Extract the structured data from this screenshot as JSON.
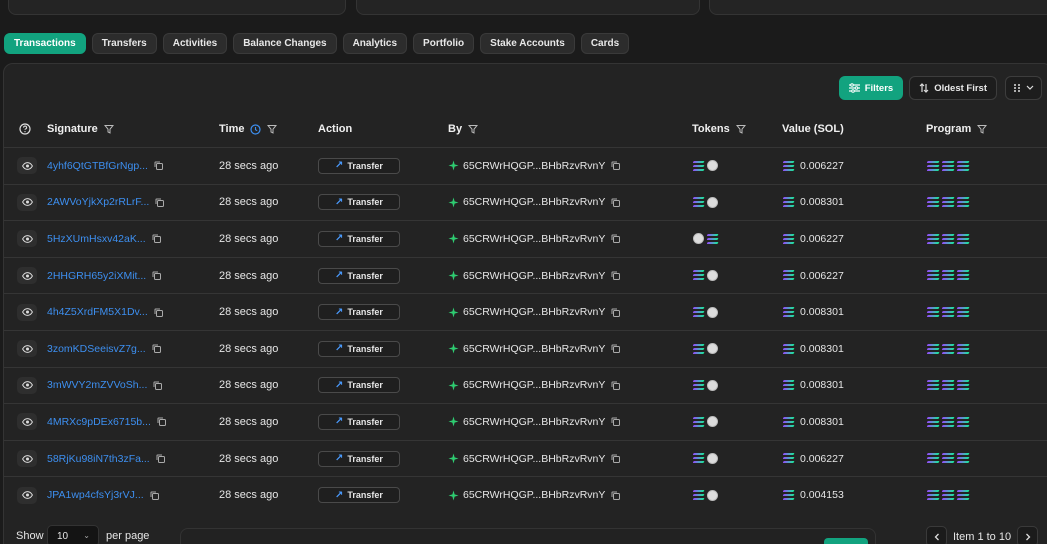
{
  "tabs": [
    {
      "label": "Transactions",
      "active": true
    },
    {
      "label": "Transfers"
    },
    {
      "label": "Activities"
    },
    {
      "label": "Balance Changes"
    },
    {
      "label": "Analytics"
    },
    {
      "label": "Portfolio"
    },
    {
      "label": "Stake Accounts"
    },
    {
      "label": "Cards"
    }
  ],
  "toolbar": {
    "filters_label": "Filters",
    "sort_label": "Oldest First"
  },
  "columns": {
    "signature": "Signature",
    "time": "Time",
    "action": "Action",
    "by": "By",
    "tokens": "Tokens",
    "value": "Value (SOL)",
    "program": "Program"
  },
  "rows": [
    {
      "signature": "4yhf6QtGTBfGrNgp...",
      "time": "28 secs ago",
      "action": "Transfer",
      "by": "65CRWrHQGP...BHbRzvRvnY",
      "tokens_order": [
        "sol",
        "coin"
      ],
      "value": "0.006227"
    },
    {
      "signature": "2AWVoYjkXp2rRLrF...",
      "time": "28 secs ago",
      "action": "Transfer",
      "by": "65CRWrHQGP...BHbRzvRvnY",
      "tokens_order": [
        "sol",
        "coin"
      ],
      "value": "0.008301"
    },
    {
      "signature": "5HzXUmHsxv42aK...",
      "time": "28 secs ago",
      "action": "Transfer",
      "by": "65CRWrHQGP...BHbRzvRvnY",
      "tokens_order": [
        "coin",
        "sol"
      ],
      "value": "0.006227"
    },
    {
      "signature": "2HHGRH65y2iXMit...",
      "time": "28 secs ago",
      "action": "Transfer",
      "by": "65CRWrHQGP...BHbRzvRvnY",
      "tokens_order": [
        "sol",
        "coin"
      ],
      "value": "0.006227"
    },
    {
      "signature": "4h4Z5XrdFM5X1Dv...",
      "time": "28 secs ago",
      "action": "Transfer",
      "by": "65CRWrHQGP...BHbRzvRvnY",
      "tokens_order": [
        "sol",
        "coin"
      ],
      "value": "0.008301"
    },
    {
      "signature": "3zomKDSeeisvZ7g...",
      "time": "28 secs ago",
      "action": "Transfer",
      "by": "65CRWrHQGP...BHbRzvRvnY",
      "tokens_order": [
        "sol",
        "coin"
      ],
      "value": "0.008301"
    },
    {
      "signature": "3mWVY2mZVVoSh...",
      "time": "28 secs ago",
      "action": "Transfer",
      "by": "65CRWrHQGP...BHbRzvRvnY",
      "tokens_order": [
        "sol",
        "coin"
      ],
      "value": "0.008301"
    },
    {
      "signature": "4MRXc9pDEx6715b...",
      "time": "28 secs ago",
      "action": "Transfer",
      "by": "65CRWrHQGP...BHbRzvRvnY",
      "tokens_order": [
        "sol",
        "coin"
      ],
      "value": "0.008301"
    },
    {
      "signature": "58RjKu98iN7th3zFa...",
      "time": "28 secs ago",
      "action": "Transfer",
      "by": "65CRWrHQGP...BHbRzvRvnY",
      "tokens_order": [
        "sol",
        "coin"
      ],
      "value": "0.006227"
    },
    {
      "signature": "JPA1wp4cfsYj3rVJ...",
      "time": "28 secs ago",
      "action": "Transfer",
      "by": "65CRWrHQGP...BHbRzvRvnY",
      "tokens_order": [
        "sol",
        "coin"
      ],
      "value": "0.004153"
    }
  ],
  "footer": {
    "show_label": "Show",
    "page_size": "10",
    "per_page_label": "per page",
    "page_info": "Item 1 to 10"
  },
  "colors": {
    "accent": "#12a37f",
    "link": "#3d8ff0",
    "background": "#1b1b1b"
  }
}
